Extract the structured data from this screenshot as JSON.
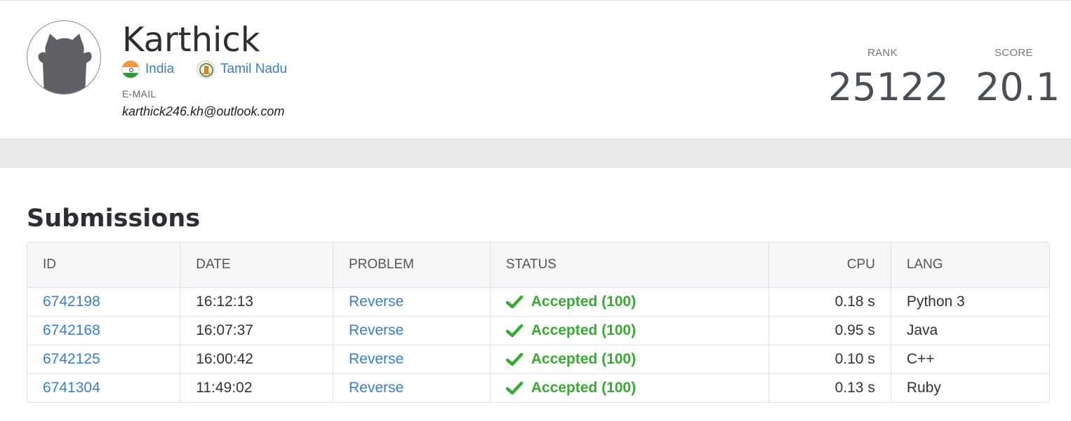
{
  "profile": {
    "name": "Karthick",
    "country": "India",
    "region": "Tamil Nadu",
    "email_label": "E-MAIL",
    "email": "karthick246.kh@outlook.com",
    "rank_label": "RANK",
    "rank": "25122",
    "score_label": "SCORE",
    "score": "20.1"
  },
  "submissions": {
    "title": "Submissions",
    "columns": {
      "id": "ID",
      "date": "DATE",
      "problem": "PROBLEM",
      "status": "STATUS",
      "cpu": "CPU",
      "lang": "LANG"
    },
    "rows": [
      {
        "id": "6742198",
        "date": "16:12:13",
        "problem": "Reverse",
        "status": "Accepted (100)",
        "cpu": "0.18 s",
        "lang": "Python 3"
      },
      {
        "id": "6742168",
        "date": "16:07:37",
        "problem": "Reverse",
        "status": "Accepted (100)",
        "cpu": "0.95 s",
        "lang": "Java"
      },
      {
        "id": "6742125",
        "date": "16:00:42",
        "problem": "Reverse",
        "status": "Accepted (100)",
        "cpu": "0.10 s",
        "lang": "C++"
      },
      {
        "id": "6741304",
        "date": "11:49:02",
        "problem": "Reverse",
        "status": "Accepted (100)",
        "cpu": "0.13 s",
        "lang": "Ruby"
      }
    ]
  },
  "colors": {
    "link": "#3b7fc4",
    "accepted": "#3aaa35",
    "heading": "#2b2f33"
  },
  "icons": {
    "avatar": "cat-silhouette-avatar",
    "country_flag": "india-flag-icon",
    "region_emblem": "tamil-nadu-emblem-icon",
    "status": "checkmark-icon"
  }
}
